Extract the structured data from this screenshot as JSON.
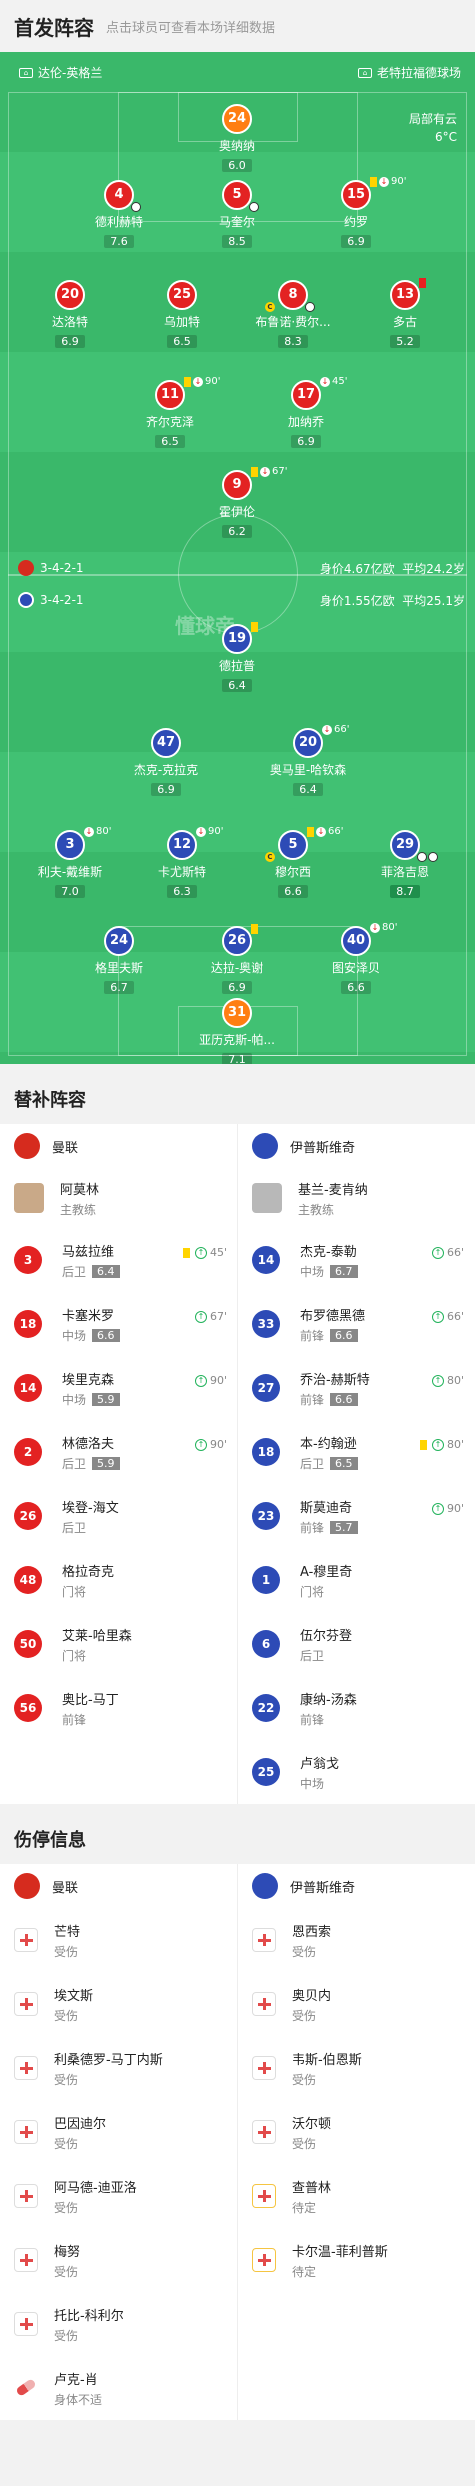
{
  "header": {
    "title": "首发阵容",
    "subtitle": "点击球员可查看本场详细数据"
  },
  "field": {
    "home_venue": "达伦-英格兰",
    "away_venue": "老特拉福德球场",
    "weather_line1": "局部有云",
    "weather_line2": "6°C",
    "watermark": "懂球帝",
    "home_formation": "3-4-2-1",
    "home_value": "身价4.67亿欧",
    "home_age": "平均24.2岁",
    "away_formation": "3-4-2-1",
    "away_value": "身价1.55亿欧",
    "away_age": "平均25.1岁"
  },
  "home_players": [
    {
      "num": "24",
      "name": "奥纳纳",
      "rating": "6.0",
      "gk": true
    },
    {
      "num": "4",
      "name": "德利赫特",
      "rating": "7.6"
    },
    {
      "num": "5",
      "name": "马奎尔",
      "rating": "8.5"
    },
    {
      "num": "15",
      "name": "约罗",
      "rating": "6.9",
      "event": "90'"
    },
    {
      "num": "20",
      "name": "达洛特",
      "rating": "6.9"
    },
    {
      "num": "25",
      "name": "乌加特",
      "rating": "6.5"
    },
    {
      "num": "8",
      "name": "布鲁诺·费尔...",
      "rating": "8.3"
    },
    {
      "num": "13",
      "name": "多古",
      "rating": "5.2"
    },
    {
      "num": "11",
      "name": "齐尔克泽",
      "rating": "6.5",
      "event": "90'"
    },
    {
      "num": "17",
      "name": "加纳乔",
      "rating": "6.9",
      "event": "45'"
    },
    {
      "num": "9",
      "name": "霍伊伦",
      "rating": "6.2",
      "event": "67'"
    }
  ],
  "away_players": [
    {
      "num": "19",
      "name": "德拉普",
      "rating": "6.4"
    },
    {
      "num": "47",
      "name": "杰克-克拉克",
      "rating": "6.9"
    },
    {
      "num": "20",
      "name": "奥马里-哈钦森",
      "rating": "6.4",
      "event": "66'"
    },
    {
      "num": "3",
      "name": "利夫-戴维斯",
      "rating": "7.0",
      "event": "80'"
    },
    {
      "num": "12",
      "name": "卡尤斯特",
      "rating": "6.3",
      "event": "90'"
    },
    {
      "num": "5",
      "name": "穆尔西",
      "rating": "6.6",
      "event": "66'"
    },
    {
      "num": "29",
      "name": "菲洛吉恩",
      "rating": "8.7"
    },
    {
      "num": "24",
      "name": "格里夫斯",
      "rating": "6.7"
    },
    {
      "num": "26",
      "name": "达拉-奥谢",
      "rating": "6.9"
    },
    {
      "num": "40",
      "name": "图安泽贝",
      "rating": "6.6",
      "event": "80'"
    },
    {
      "num": "31",
      "name": "亚历克斯-帕...",
      "rating": "7.1",
      "gk": true
    }
  ],
  "subs": {
    "title": "替补阵容",
    "home_team": "曼联",
    "away_team": "伊普斯维奇",
    "home_coach": {
      "name": "阿莫林",
      "role": "主教练"
    },
    "away_coach": {
      "name": "基兰-麦肯纳",
      "role": "主教练"
    },
    "home": [
      {
        "num": "3",
        "name": "马兹拉维",
        "pos": "后卫",
        "rating": "6.4",
        "time": "45'",
        "yellow": true
      },
      {
        "num": "18",
        "name": "卡塞米罗",
        "pos": "中场",
        "rating": "6.6",
        "time": "67'"
      },
      {
        "num": "14",
        "name": "埃里克森",
        "pos": "中场",
        "rating": "5.9",
        "time": "90'"
      },
      {
        "num": "2",
        "name": "林德洛夫",
        "pos": "后卫",
        "rating": "5.9",
        "time": "90'"
      },
      {
        "num": "26",
        "name": "埃登-海文",
        "pos": "后卫"
      },
      {
        "num": "48",
        "name": "格拉奇克",
        "pos": "门将"
      },
      {
        "num": "50",
        "name": "艾莱-哈里森",
        "pos": "门将"
      },
      {
        "num": "56",
        "name": "奥比-马丁",
        "pos": "前锋"
      }
    ],
    "away": [
      {
        "num": "14",
        "name": "杰克-泰勒",
        "pos": "中场",
        "rating": "6.7",
        "time": "66'"
      },
      {
        "num": "33",
        "name": "布罗德黑德",
        "pos": "前锋",
        "rating": "6.6",
        "time": "66'"
      },
      {
        "num": "27",
        "name": "乔治-赫斯特",
        "pos": "前锋",
        "rating": "6.6",
        "time": "80'"
      },
      {
        "num": "18",
        "name": "本-约翰逊",
        "pos": "后卫",
        "rating": "6.5",
        "time": "80'",
        "yellow": true
      },
      {
        "num": "23",
        "name": "斯莫迪奇",
        "pos": "前锋",
        "rating": "5.7",
        "time": "90'"
      },
      {
        "num": "1",
        "name": "A-穆里奇",
        "pos": "门将"
      },
      {
        "num": "6",
        "name": "伍尔芬登",
        "pos": "后卫"
      },
      {
        "num": "22",
        "name": "康纳-汤森",
        "pos": "前锋"
      },
      {
        "num": "25",
        "name": "卢翁戈",
        "pos": "中场"
      }
    ]
  },
  "injuries": {
    "title": "伤停信息",
    "home_team": "曼联",
    "away_team": "伊普斯维奇",
    "home": [
      {
        "name": "芒特",
        "status": "受伤"
      },
      {
        "name": "埃文斯",
        "status": "受伤"
      },
      {
        "name": "利桑德罗-马丁内斯",
        "status": "受伤"
      },
      {
        "name": "巴因迪尔",
        "status": "受伤"
      },
      {
        "name": "阿马德-迪亚洛",
        "status": "受伤"
      },
      {
        "name": "梅努",
        "status": "受伤"
      },
      {
        "name": "托比-科利尔",
        "status": "受伤"
      },
      {
        "name": "卢克-肖",
        "status": "身体不适",
        "pill": true
      }
    ],
    "away": [
      {
        "name": "恩西索",
        "status": "受伤"
      },
      {
        "name": "奥贝内",
        "status": "受伤"
      },
      {
        "name": "韦斯-伯恩斯",
        "status": "受伤"
      },
      {
        "name": "沃尔顿",
        "status": "受伤"
      },
      {
        "name": "查普林",
        "status": "待定"
      },
      {
        "name": "卡尔温-菲利普斯",
        "status": "待定"
      }
    ]
  },
  "colors": {
    "home": "#e32222",
    "away": "#2d4bb6",
    "pitch": "#3ab86a",
    "up": "#23b35c"
  }
}
